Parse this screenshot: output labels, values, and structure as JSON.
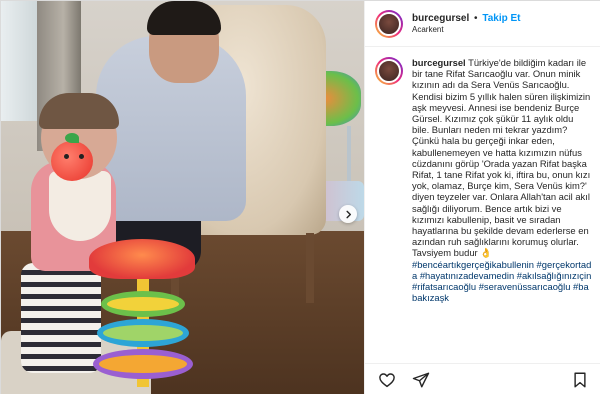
{
  "post": {
    "username": "burcegursel",
    "follow_label": "Takip Et",
    "separator": "•",
    "location": "Acarkent",
    "caption_username": "burcegursel",
    "caption_text": " Türkiye'de bildiğim kadarı ile bir tane Rifat Sarıcaoğlu var. Onun minik kızının adı da Sera Venüs Sarıcaoğlu. Kendisi bizim 5 yıllık halen süren ilişkimizin aşk meyvesi. Annesi ise bendeniz Burçe Gürsel. Kızımız çok şükür 11 aylık oldu bile. Bunları neden mi tekrar yazdım? Çünkü hala bu gerçeği inkar eden, kabullenemeyen ve hatta kızımızın nüfus cüzdanını görüp 'Orada yazan Rifat başka Rifat, 1 tane Rifat yok ki, iftira bu, onun kızı yok, olamaz, Burçe kim, Sera Venüs kim?' diyen teyzeler var. Onlara Allah'tan acil akıl sağlığı diliyorum. Bence artık bizi ve kızımızı kabullenip, basit ve sıradan hayatlarına bu şekilde devam ederlerse en azından ruh sağlıklarını korumuş olurlar. Tavsiyem budur 👌",
    "hashtags": "#bencéartıkgerçeğikabullenin #gerçekortada #hayatınızadevamedin #akılsağlığınızıçin #rifatsarıcaoğlu #seravenüssarıcaoğlu #babakızaşk"
  },
  "icons": {
    "next": "chevron-right-icon",
    "like": "heart-icon",
    "share": "paper-plane-icon",
    "save": "bookmark-icon"
  },
  "colors": {
    "follow": "#0095f6",
    "hashtag": "#00376b",
    "text": "#262626",
    "border": "#dbdbdb"
  }
}
